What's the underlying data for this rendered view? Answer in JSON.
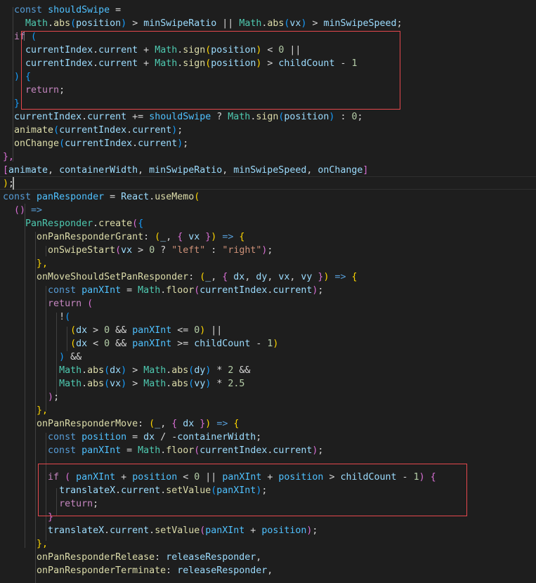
{
  "editor": {
    "lines": [
      [
        [
          "  ",
          "p"
        ],
        [
          "const",
          "k"
        ],
        [
          " ",
          "p"
        ],
        [
          "shouldSwipe",
          "s"
        ],
        [
          " =",
          "p"
        ]
      ],
      [
        [
          "    ",
          "p"
        ],
        [
          "Math",
          "ty"
        ],
        [
          ".",
          "p"
        ],
        [
          "abs",
          "f"
        ],
        [
          "(",
          "b3"
        ],
        [
          "position",
          "v"
        ],
        [
          ")",
          "b3"
        ],
        [
          " > ",
          "p"
        ],
        [
          "minSwipeRatio",
          "v"
        ],
        [
          " || ",
          "p"
        ],
        [
          "Math",
          "ty"
        ],
        [
          ".",
          "p"
        ],
        [
          "abs",
          "f"
        ],
        [
          "(",
          "b3"
        ],
        [
          "vx",
          "v"
        ],
        [
          ")",
          "b3"
        ],
        [
          " > ",
          "p"
        ],
        [
          "minSwipeSpeed",
          "v"
        ],
        [
          ";",
          "p"
        ]
      ],
      [
        [
          "  ",
          "p"
        ],
        [
          "if",
          "c"
        ],
        [
          " ",
          "p"
        ],
        [
          "(",
          "b3"
        ]
      ],
      [
        [
          "    ",
          "p"
        ],
        [
          "currentIndex",
          "v"
        ],
        [
          ".",
          "p"
        ],
        [
          "current",
          "v"
        ],
        [
          " + ",
          "p"
        ],
        [
          "Math",
          "ty"
        ],
        [
          ".",
          "p"
        ],
        [
          "sign",
          "f"
        ],
        [
          "(",
          "b1"
        ],
        [
          "position",
          "v"
        ],
        [
          ")",
          "b1"
        ],
        [
          " < ",
          "p"
        ],
        [
          "0",
          "n"
        ],
        [
          " ||",
          "p"
        ]
      ],
      [
        [
          "    ",
          "p"
        ],
        [
          "currentIndex",
          "v"
        ],
        [
          ".",
          "p"
        ],
        [
          "current",
          "v"
        ],
        [
          " + ",
          "p"
        ],
        [
          "Math",
          "ty"
        ],
        [
          ".",
          "p"
        ],
        [
          "sign",
          "f"
        ],
        [
          "(",
          "b1"
        ],
        [
          "position",
          "v"
        ],
        [
          ")",
          "b1"
        ],
        [
          " > ",
          "p"
        ],
        [
          "childCount",
          "v"
        ],
        [
          " - ",
          "p"
        ],
        [
          "1",
          "n"
        ]
      ],
      [
        [
          "  ",
          "p"
        ],
        [
          ")",
          "b3"
        ],
        [
          " ",
          "p"
        ],
        [
          "{",
          "b3"
        ]
      ],
      [
        [
          "    ",
          "p"
        ],
        [
          "return",
          "c"
        ],
        [
          ";",
          "p"
        ]
      ],
      [
        [
          "  ",
          "p"
        ],
        [
          "}",
          "b3"
        ]
      ],
      [
        [
          "  ",
          "p"
        ],
        [
          "currentIndex",
          "v"
        ],
        [
          ".",
          "p"
        ],
        [
          "current",
          "v"
        ],
        [
          " += ",
          "p"
        ],
        [
          "shouldSwipe",
          "s"
        ],
        [
          " ? ",
          "p"
        ],
        [
          "Math",
          "ty"
        ],
        [
          ".",
          "p"
        ],
        [
          "sign",
          "f"
        ],
        [
          "(",
          "b3"
        ],
        [
          "position",
          "v"
        ],
        [
          ")",
          "b3"
        ],
        [
          " : ",
          "p"
        ],
        [
          "0",
          "n"
        ],
        [
          ";",
          "p"
        ]
      ],
      [
        [
          "  ",
          "p"
        ],
        [
          "animate",
          "f"
        ],
        [
          "(",
          "b3"
        ],
        [
          "currentIndex",
          "v"
        ],
        [
          ".",
          "p"
        ],
        [
          "current",
          "v"
        ],
        [
          ")",
          "b3"
        ],
        [
          ";",
          "p"
        ]
      ],
      [
        [
          "  ",
          "p"
        ],
        [
          "onChange",
          "f"
        ],
        [
          "(",
          "b3"
        ],
        [
          "currentIndex",
          "v"
        ],
        [
          ".",
          "p"
        ],
        [
          "current",
          "v"
        ],
        [
          ")",
          "b3"
        ],
        [
          ";",
          "p"
        ]
      ],
      [
        [
          "},",
          "b2"
        ]
      ],
      [
        [
          "[",
          "b2"
        ],
        [
          "animate",
          "v"
        ],
        [
          ", ",
          "p"
        ],
        [
          "containerWidth",
          "v"
        ],
        [
          ", ",
          "p"
        ],
        [
          "minSwipeRatio",
          "v"
        ],
        [
          ", ",
          "p"
        ],
        [
          "minSwipeSpeed",
          "v"
        ],
        [
          ", ",
          "p"
        ],
        [
          "onChange",
          "v"
        ],
        [
          "]",
          "b2"
        ]
      ],
      [
        [
          ")",
          "b1"
        ],
        [
          ";",
          "p"
        ]
      ],
      [
        [
          "const",
          "k"
        ],
        [
          " ",
          "p"
        ],
        [
          "panResponder",
          "s"
        ],
        [
          " = ",
          "p"
        ],
        [
          "React",
          "v"
        ],
        [
          ".",
          "p"
        ],
        [
          "useMemo",
          "f"
        ],
        [
          "(",
          "b1"
        ]
      ],
      [
        [
          "  ",
          "p"
        ],
        [
          "()",
          "b2"
        ],
        [
          " ",
          "p"
        ],
        [
          "=>",
          "k"
        ]
      ],
      [
        [
          "    ",
          "p"
        ],
        [
          "PanResponder",
          "ty"
        ],
        [
          ".",
          "p"
        ],
        [
          "create",
          "f"
        ],
        [
          "(",
          "b2"
        ],
        [
          "{",
          "b3"
        ]
      ],
      [
        [
          "      ",
          "p"
        ],
        [
          "onPanResponderGrant",
          "f"
        ],
        [
          ": ",
          "p"
        ],
        [
          "(",
          "b1"
        ],
        [
          "_",
          "v"
        ],
        [
          ", ",
          "p"
        ],
        [
          "{",
          "b2"
        ],
        [
          " vx ",
          "v"
        ],
        [
          "}",
          "b2"
        ],
        [
          ")",
          "b1"
        ],
        [
          " ",
          "p"
        ],
        [
          "=>",
          "k"
        ],
        [
          " ",
          "p"
        ],
        [
          "{",
          "b1"
        ]
      ],
      [
        [
          "        ",
          "p"
        ],
        [
          "onSwipeStart",
          "f"
        ],
        [
          "(",
          "b2"
        ],
        [
          "vx",
          "v"
        ],
        [
          " > ",
          "p"
        ],
        [
          "0",
          "n"
        ],
        [
          " ? ",
          "p"
        ],
        [
          "\"left\"",
          "st"
        ],
        [
          " : ",
          "p"
        ],
        [
          "\"right\"",
          "st"
        ],
        [
          ")",
          "b2"
        ],
        [
          ";",
          "p"
        ]
      ],
      [
        [
          "      ",
          "p"
        ],
        [
          "},",
          "b1"
        ]
      ],
      [
        [
          "      ",
          "p"
        ],
        [
          "onMoveShouldSetPanResponder",
          "f"
        ],
        [
          ": ",
          "p"
        ],
        [
          "(",
          "b1"
        ],
        [
          "_",
          "v"
        ],
        [
          ", ",
          "p"
        ],
        [
          "{",
          "b2"
        ],
        [
          " dx",
          "v"
        ],
        [
          ", ",
          "p"
        ],
        [
          "dy",
          "v"
        ],
        [
          ", ",
          "p"
        ],
        [
          "vx",
          "v"
        ],
        [
          ", ",
          "p"
        ],
        [
          "vy ",
          "v"
        ],
        [
          "}",
          "b2"
        ],
        [
          ")",
          "b1"
        ],
        [
          " ",
          "p"
        ],
        [
          "=>",
          "k"
        ],
        [
          " ",
          "p"
        ],
        [
          "{",
          "b1"
        ]
      ],
      [
        [
          "        ",
          "p"
        ],
        [
          "const",
          "k"
        ],
        [
          " ",
          "p"
        ],
        [
          "panXInt",
          "s"
        ],
        [
          " = ",
          "p"
        ],
        [
          "Math",
          "ty"
        ],
        [
          ".",
          "p"
        ],
        [
          "floor",
          "f"
        ],
        [
          "(",
          "b2"
        ],
        [
          "currentIndex",
          "v"
        ],
        [
          ".",
          "p"
        ],
        [
          "current",
          "v"
        ],
        [
          ")",
          "b2"
        ],
        [
          ";",
          "p"
        ]
      ],
      [
        [
          "        ",
          "p"
        ],
        [
          "return",
          "c"
        ],
        [
          " ",
          "p"
        ],
        [
          "(",
          "b2"
        ]
      ],
      [
        [
          "          ",
          "p"
        ],
        [
          "!",
          "p"
        ],
        [
          "(",
          "b3"
        ]
      ],
      [
        [
          "            ",
          "p"
        ],
        [
          "(",
          "b1"
        ],
        [
          "dx",
          "v"
        ],
        [
          " > ",
          "p"
        ],
        [
          "0",
          "n"
        ],
        [
          " && ",
          "p"
        ],
        [
          "panXInt",
          "s"
        ],
        [
          " <= ",
          "p"
        ],
        [
          "0",
          "n"
        ],
        [
          ")",
          "b1"
        ],
        [
          " ||",
          "p"
        ]
      ],
      [
        [
          "            ",
          "p"
        ],
        [
          "(",
          "b1"
        ],
        [
          "dx",
          "v"
        ],
        [
          " < ",
          "p"
        ],
        [
          "0",
          "n"
        ],
        [
          " && ",
          "p"
        ],
        [
          "panXInt",
          "s"
        ],
        [
          " >= ",
          "p"
        ],
        [
          "childCount",
          "v"
        ],
        [
          " - ",
          "p"
        ],
        [
          "1",
          "n"
        ],
        [
          ")",
          "b1"
        ]
      ],
      [
        [
          "          ",
          "p"
        ],
        [
          ")",
          "b3"
        ],
        [
          " &&",
          "p"
        ]
      ],
      [
        [
          "          ",
          "p"
        ],
        [
          "Math",
          "ty"
        ],
        [
          ".",
          "p"
        ],
        [
          "abs",
          "f"
        ],
        [
          "(",
          "b3"
        ],
        [
          "dx",
          "v"
        ],
        [
          ")",
          "b3"
        ],
        [
          " > ",
          "p"
        ],
        [
          "Math",
          "ty"
        ],
        [
          ".",
          "p"
        ],
        [
          "abs",
          "f"
        ],
        [
          "(",
          "b3"
        ],
        [
          "dy",
          "v"
        ],
        [
          ")",
          "b3"
        ],
        [
          " * ",
          "p"
        ],
        [
          "2",
          "n"
        ],
        [
          " &&",
          "p"
        ]
      ],
      [
        [
          "          ",
          "p"
        ],
        [
          "Math",
          "ty"
        ],
        [
          ".",
          "p"
        ],
        [
          "abs",
          "f"
        ],
        [
          "(",
          "b3"
        ],
        [
          "vx",
          "v"
        ],
        [
          ")",
          "b3"
        ],
        [
          " > ",
          "p"
        ],
        [
          "Math",
          "ty"
        ],
        [
          ".",
          "p"
        ],
        [
          "abs",
          "f"
        ],
        [
          "(",
          "b3"
        ],
        [
          "vy",
          "v"
        ],
        [
          ")",
          "b3"
        ],
        [
          " * ",
          "p"
        ],
        [
          "2.5",
          "n"
        ]
      ],
      [
        [
          "        ",
          "p"
        ],
        [
          ")",
          "b2"
        ],
        [
          ";",
          "p"
        ]
      ],
      [
        [
          "      ",
          "p"
        ],
        [
          "},",
          "b1"
        ]
      ],
      [
        [
          "      ",
          "p"
        ],
        [
          "onPanResponderMove",
          "f"
        ],
        [
          ": ",
          "p"
        ],
        [
          "(",
          "b1"
        ],
        [
          "_",
          "v"
        ],
        [
          ", ",
          "p"
        ],
        [
          "{",
          "b2"
        ],
        [
          " dx ",
          "v"
        ],
        [
          "}",
          "b2"
        ],
        [
          ")",
          "b1"
        ],
        [
          " ",
          "p"
        ],
        [
          "=>",
          "k"
        ],
        [
          " ",
          "p"
        ],
        [
          "{",
          "b1"
        ]
      ],
      [
        [
          "        ",
          "p"
        ],
        [
          "const",
          "k"
        ],
        [
          " ",
          "p"
        ],
        [
          "position",
          "s"
        ],
        [
          " = ",
          "p"
        ],
        [
          "dx",
          "v"
        ],
        [
          " / -",
          "p"
        ],
        [
          "containerWidth",
          "v"
        ],
        [
          ";",
          "p"
        ]
      ],
      [
        [
          "        ",
          "p"
        ],
        [
          "const",
          "k"
        ],
        [
          " ",
          "p"
        ],
        [
          "panXInt",
          "s"
        ],
        [
          " = ",
          "p"
        ],
        [
          "Math",
          "ty"
        ],
        [
          ".",
          "p"
        ],
        [
          "floor",
          "f"
        ],
        [
          "(",
          "b2"
        ],
        [
          "currentIndex",
          "v"
        ],
        [
          ".",
          "p"
        ],
        [
          "current",
          "v"
        ],
        [
          ")",
          "b2"
        ],
        [
          ";",
          "p"
        ]
      ],
      [],
      [
        [
          "        ",
          "p"
        ],
        [
          "if",
          "c"
        ],
        [
          " ",
          "p"
        ],
        [
          "(",
          "b2"
        ],
        [
          " ",
          "p"
        ],
        [
          "panXInt",
          "s"
        ],
        [
          " + ",
          "p"
        ],
        [
          "position",
          "s"
        ],
        [
          " < ",
          "p"
        ],
        [
          "0",
          "n"
        ],
        [
          " || ",
          "p"
        ],
        [
          "panXInt",
          "s"
        ],
        [
          " + ",
          "p"
        ],
        [
          "position",
          "s"
        ],
        [
          " > ",
          "p"
        ],
        [
          "childCount",
          "v"
        ],
        [
          " - ",
          "p"
        ],
        [
          "1",
          "n"
        ],
        [
          ")",
          "b2"
        ],
        [
          " ",
          "p"
        ],
        [
          "{",
          "b2"
        ]
      ],
      [
        [
          "          ",
          "p"
        ],
        [
          "translateX",
          "v"
        ],
        [
          ".",
          "p"
        ],
        [
          "current",
          "v"
        ],
        [
          ".",
          "p"
        ],
        [
          "setValue",
          "f"
        ],
        [
          "(",
          "b3"
        ],
        [
          "panXInt",
          "s"
        ],
        [
          ")",
          "b3"
        ],
        [
          ";",
          "p"
        ]
      ],
      [
        [
          "          ",
          "p"
        ],
        [
          "return",
          "c"
        ],
        [
          ";",
          "p"
        ]
      ],
      [
        [
          "        ",
          "p"
        ],
        [
          "}",
          "b2"
        ]
      ],
      [
        [
          "        ",
          "p"
        ],
        [
          "translateX",
          "v"
        ],
        [
          ".",
          "p"
        ],
        [
          "current",
          "v"
        ],
        [
          ".",
          "p"
        ],
        [
          "setValue",
          "f"
        ],
        [
          "(",
          "b2"
        ],
        [
          "panXInt",
          "s"
        ],
        [
          " + ",
          "p"
        ],
        [
          "position",
          "s"
        ],
        [
          ")",
          "b2"
        ],
        [
          ";",
          "p"
        ]
      ],
      [
        [
          "      ",
          "p"
        ],
        [
          "},",
          "b1"
        ]
      ],
      [
        [
          "      ",
          "p"
        ],
        [
          "onPanResponderRelease",
          "f"
        ],
        [
          ": ",
          "p"
        ],
        [
          "releaseResponder",
          "v"
        ],
        [
          ",",
          "p"
        ]
      ],
      [
        [
          "      ",
          "p"
        ],
        [
          "onPanResponderTerminate",
          "f"
        ],
        [
          ": ",
          "p"
        ],
        [
          "releaseResponder",
          "v"
        ],
        [
          ",",
          "p"
        ]
      ]
    ]
  },
  "colors": {
    "background": "#1e1e1e",
    "highlight_border": "#e5484d"
  }
}
